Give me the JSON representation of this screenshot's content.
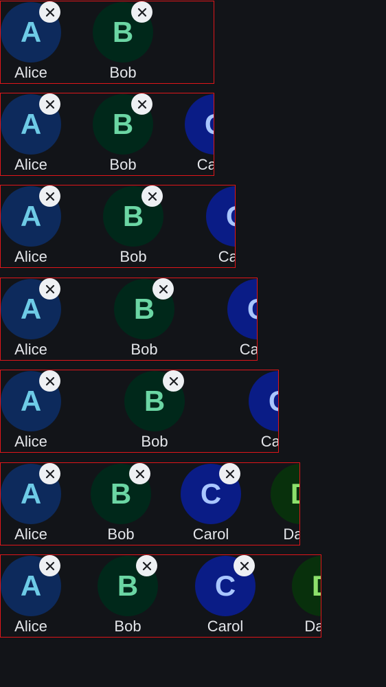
{
  "colors": {
    "background": "#121418",
    "row_border": "#e0161a",
    "name_text": "#e4e6ea",
    "close_bg": "#eef0f3",
    "close_x": "#1b1d21"
  },
  "icons": {
    "remove": "close-icon"
  },
  "people": [
    {
      "initial": "A",
      "name": "Alice",
      "avatar_bg": "#0d2a5c",
      "initial_color": "#6ecbe6"
    },
    {
      "initial": "B",
      "name": "Bob",
      "avatar_bg": "#00281a",
      "initial_color": "#6bd6a4"
    },
    {
      "initial": "C",
      "name": "Carol",
      "avatar_bg": "#0a1c86",
      "initial_color": "#a9c6ff"
    },
    {
      "initial": "D",
      "name": "Dave",
      "avatar_bg": "#08300c",
      "initial_color": "#8de06b"
    }
  ],
  "rows": [
    {
      "count": 2,
      "removable": 2
    },
    {
      "count": 3,
      "removable": 2
    },
    {
      "count": 3,
      "removable": 2
    },
    {
      "count": 3,
      "removable": 2
    },
    {
      "count": 3,
      "removable": 2
    },
    {
      "count": 4,
      "removable": 3
    },
    {
      "count": 4,
      "removable": 3
    }
  ]
}
